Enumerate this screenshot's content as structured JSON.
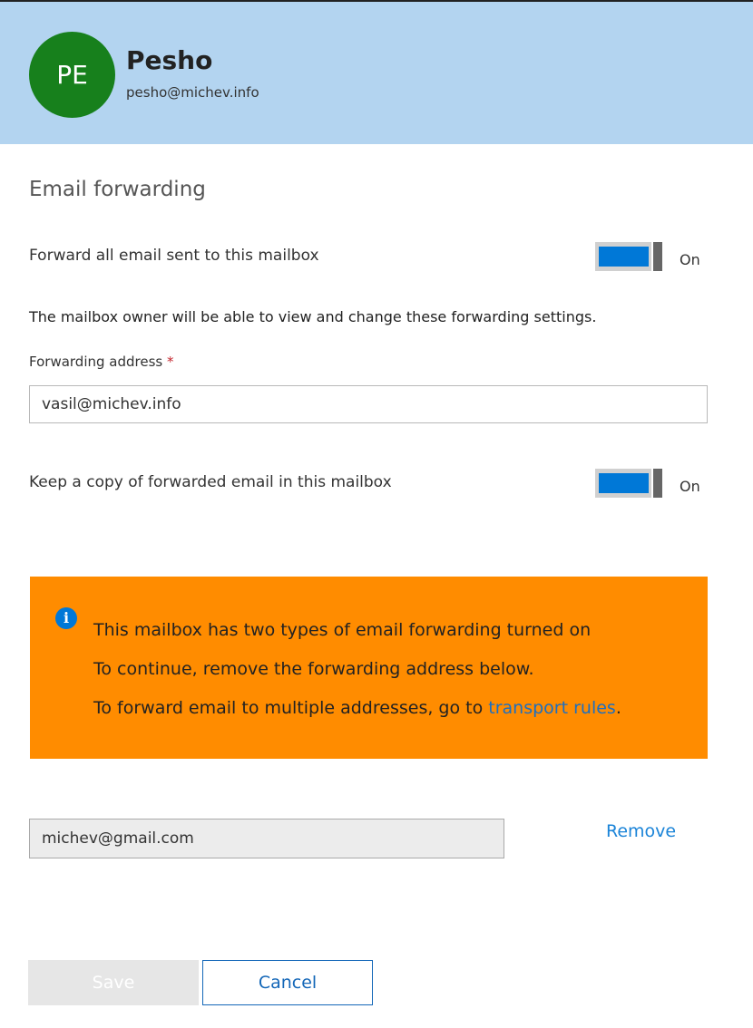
{
  "user": {
    "initials": "PE",
    "name": "Pesho",
    "email": "pesho@michev.info",
    "avatar_color": "#17801c"
  },
  "panel": {
    "title": "Email forwarding",
    "forward_all": {
      "label": "Forward all email sent to this mailbox",
      "state": "On",
      "enabled": true
    },
    "owner_note": "The mailbox owner will be able to view and change these forwarding settings.",
    "forwarding_address": {
      "label": "Forwarding address",
      "required_marker": "*",
      "value": "vasil@michev.info"
    },
    "keep_copy": {
      "label": "Keep a copy of forwarded email in this mailbox",
      "state": "On",
      "enabled": true
    }
  },
  "warning": {
    "icon": "info-icon",
    "icon_glyph": "i",
    "line1": "This mailbox has two types of email forwarding turned on",
    "line2": "To continue, remove the forwarding address below.",
    "line3_prefix": "To forward email to multiple addresses, go to ",
    "line3_link": "transport rules",
    "line3_suffix": ".",
    "background": "#ff8c00"
  },
  "existing_forward": {
    "address": "michev@gmail.com",
    "remove_label": "Remove"
  },
  "actions": {
    "save_label": "Save",
    "cancel_label": "Cancel"
  },
  "colors": {
    "header_bg": "#b3d4f0",
    "accent": "#0078d7",
    "link": "#1b6fc2"
  }
}
